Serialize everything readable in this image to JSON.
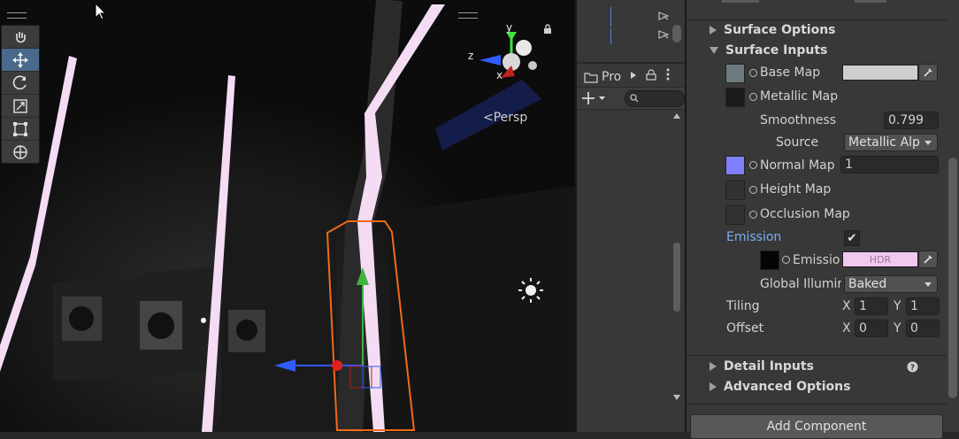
{
  "scene": {
    "persp_label": "Persp",
    "axis_labels": {
      "y": "y",
      "z": "z",
      "x": "x"
    }
  },
  "project": {
    "tab_label": "Pro"
  },
  "inspector": {
    "surface_options": "Surface Options",
    "surface_inputs": "Surface Inputs",
    "base_map": "Base Map",
    "metallic_map": "Metallic Map",
    "smoothness_label": "Smoothness",
    "smoothness_value": "0.799",
    "source_label": "Source",
    "source_value": "Metallic Alp",
    "normal_map": "Normal Map",
    "normal_value": "1",
    "height_map": "Height Map",
    "occlusion_map": "Occlusion Map",
    "emission_label": "Emission",
    "emission_map": "Emissio",
    "emission_hdr": "HDR",
    "gi_label": "Global Illumir",
    "gi_value": "Baked",
    "tiling_label": "Tiling",
    "tiling_x_label": "X",
    "tiling_x": "1",
    "tiling_y_label": "Y",
    "tiling_y": "1",
    "offset_label": "Offset",
    "offset_x_label": "X",
    "offset_x": "0",
    "offset_y_label": "Y",
    "offset_y": "0",
    "detail_inputs": "Detail Inputs",
    "advanced_options": "Advanced Options",
    "add_component": "Add Component"
  },
  "colors": {
    "accent_blue": "#7ab0f0",
    "normal_swatch": "#8080ff",
    "emission_swatch": "#f0c8f0",
    "selection_outline": "#f06a1a"
  }
}
